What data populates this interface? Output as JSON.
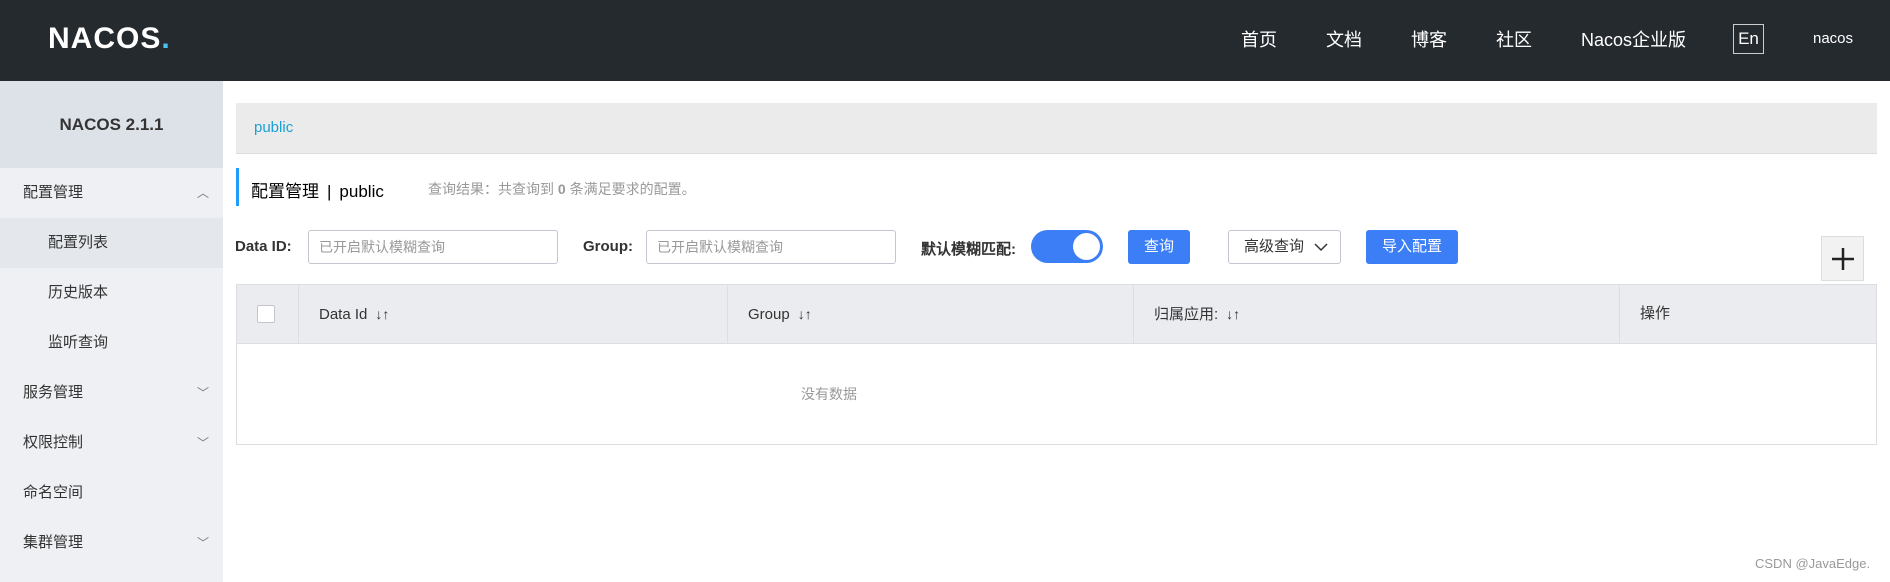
{
  "header": {
    "logo_main": "NACOS",
    "logo_dot": ".",
    "nav": [
      "首页",
      "文档",
      "博客",
      "社区",
      "Nacos企业版"
    ],
    "lang": "En",
    "user": "nacos"
  },
  "sidebar": {
    "version": "NACOS 2.1.1",
    "items": [
      {
        "label": "配置管理",
        "chevron": "chevron-up"
      },
      {
        "label": "配置列表"
      },
      {
        "label": "历史版本"
      },
      {
        "label": "监听查询"
      },
      {
        "label": "服务管理",
        "chevron": "chevron-down"
      },
      {
        "label": "权限控制",
        "chevron": "chevron-down"
      },
      {
        "label": "命名空间"
      },
      {
        "label": "集群管理",
        "chevron": "chevron-down"
      }
    ]
  },
  "main": {
    "namespace": "public",
    "title": "配置管理",
    "title_sep": "|",
    "title_ns": "public",
    "query_prefix": "查询结果：共查询到",
    "query_count": "0",
    "query_suffix": "条满足要求的配置。",
    "filters": {
      "dataid_label": "Data ID:",
      "dataid_placeholder": "已开启默认模糊查询",
      "group_label": "Group:",
      "group_placeholder": "已开启默认模糊查询",
      "fuzzy_label": "默认模糊匹配:",
      "fuzzy_on": true,
      "query_btn": "查询",
      "advanced_btn": "高级查询",
      "import_btn": "导入配置"
    },
    "table": {
      "columns": [
        "Data Id",
        "Group",
        "归属应用:",
        "操作"
      ],
      "empty": "没有数据"
    }
  },
  "watermark": "CSDN @JavaEdge.",
  "colors": {
    "header_bg": "#252a2f",
    "primary": "#3b7ef6",
    "link": "#1aa1d3"
  }
}
